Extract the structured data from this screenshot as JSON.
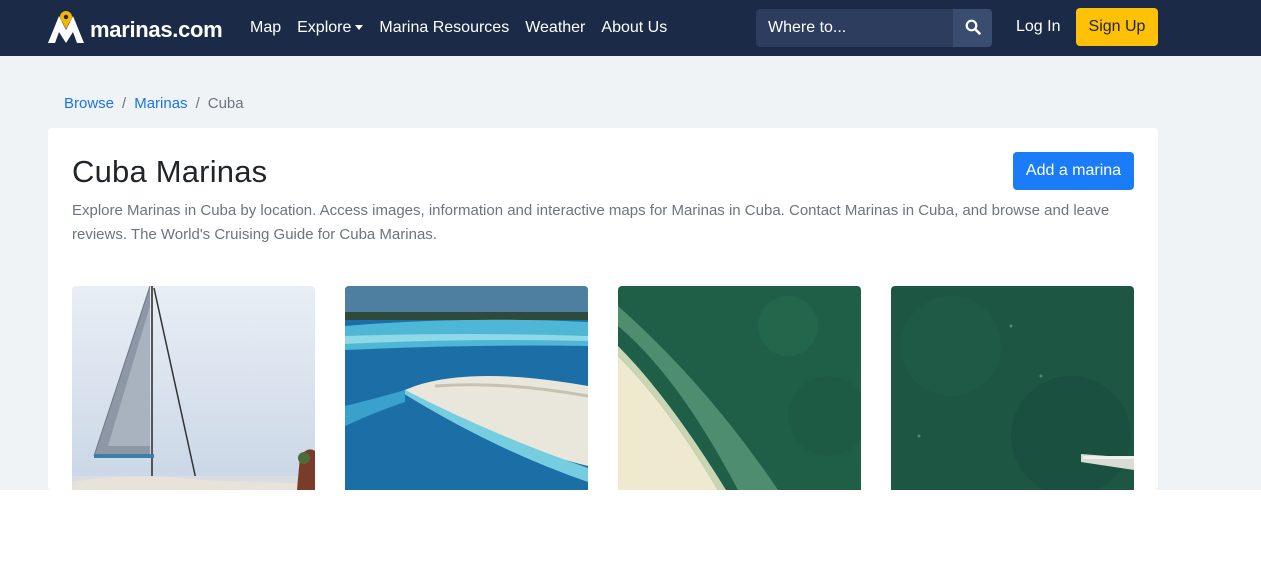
{
  "brand": {
    "name": "marinas.com"
  },
  "nav": {
    "items": [
      {
        "label": "Map"
      },
      {
        "label": "Explore",
        "has_dropdown": true
      },
      {
        "label": "Marina Resources"
      },
      {
        "label": "Weather"
      },
      {
        "label": "About Us"
      }
    ],
    "search_placeholder": "Where to...",
    "login_label": "Log In",
    "signup_label": "Sign Up"
  },
  "breadcrumb": {
    "items": [
      "Browse",
      "Marinas"
    ],
    "current": "Cuba",
    "separator": "/"
  },
  "main": {
    "title": "Cuba Marinas",
    "add_button_label": "Add a marina",
    "description": "Explore Marinas in Cuba by location. Access images, information and interactive maps for Marinas in Cuba. Contact Marinas in Cuba, and browse and leave reviews. The World's Cruising Guide for Cuba Marinas.",
    "thumbnails": [
      {
        "subject": "catamaran-sail-photo"
      },
      {
        "subject": "sandbar-aerial-photo"
      },
      {
        "subject": "shoreline-aerial-photo"
      },
      {
        "subject": "green-water-dock-aerial-photo"
      }
    ]
  },
  "colors": {
    "navbar": "#1b2a47",
    "page_background": "#f0f3f6",
    "link": "#1a73e8",
    "primary_button": "#1a7cf6",
    "signup_button": "#ffc107",
    "brand_pin": "#f5b700"
  },
  "icons": {
    "logo": "map-pin-m-logo-icon",
    "search": "search-icon",
    "dropdown": "caret-down-icon"
  }
}
